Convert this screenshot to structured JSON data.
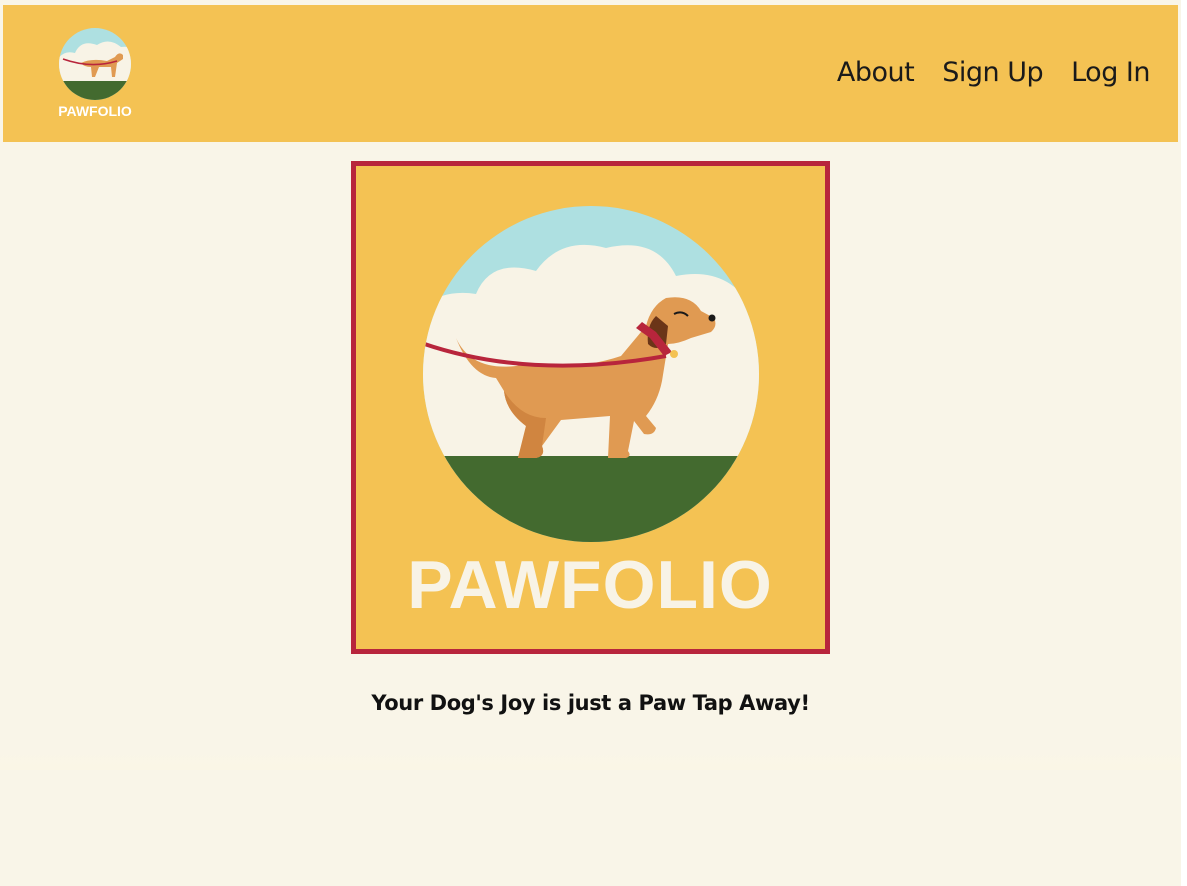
{
  "header": {
    "logo_text": "PAWFOLIO",
    "nav": [
      {
        "label": "About"
      },
      {
        "label": "Sign Up"
      },
      {
        "label": "Log In"
      }
    ]
  },
  "hero": {
    "logo_text": "PAWFOLIO"
  },
  "tagline": "Your Dog's Joy is just a Paw Tap Away!",
  "colors": {
    "header_bg": "#f4c253",
    "page_bg": "#f9f5e8",
    "hero_border": "#b8253c",
    "sky": "#aee0e1",
    "cloud": "#f8f3e6",
    "grass": "#436a2f",
    "dog": "#e09a52",
    "leash": "#b8253c"
  },
  "icons": {
    "logo": "dog-walking-icon"
  }
}
